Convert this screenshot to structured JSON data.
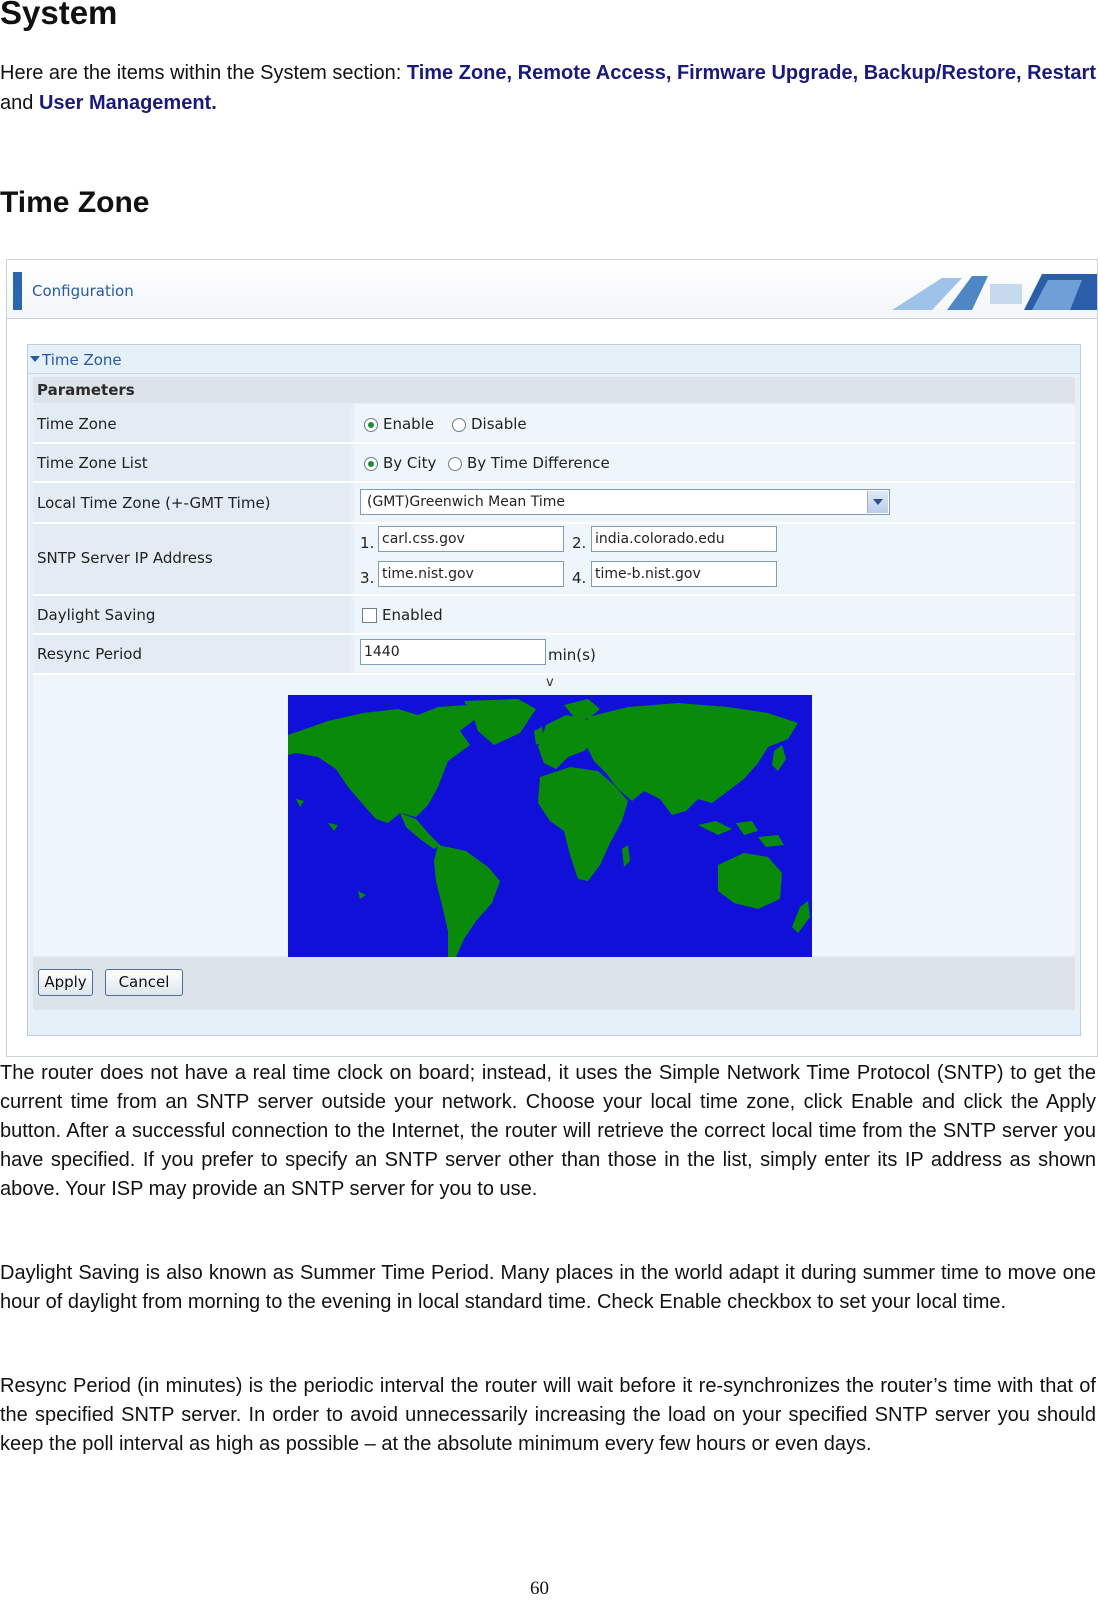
{
  "heading": "System",
  "intro": {
    "prefix": "Here are the items within the System section: ",
    "highlight1": "Time Zone, Remote Access, Firmware Upgrade, Backup/Restore, Restart",
    "middle": " and ",
    "highlight2": "User Management."
  },
  "section_heading": "Time Zone",
  "screenshot": {
    "header_title": "Configuration",
    "panel_title": "Time Zone",
    "parameters_label": "Parameters",
    "rows": {
      "time_zone": {
        "label": "Time Zone",
        "opt1": "Enable",
        "opt2": "Disable",
        "selected": "Enable"
      },
      "time_zone_list": {
        "label": "Time Zone List",
        "opt1": "By City",
        "opt2": "By Time Difference",
        "selected": "By City"
      },
      "local_tz": {
        "label": "Local Time Zone (+-GMT Time)",
        "value": "(GMT)Greenwich Mean Time"
      },
      "sntp": {
        "label": "SNTP Server IP Address",
        "n1": "1.",
        "s1": "carl.css.gov",
        "n2": "2.",
        "s2": "india.colorado.edu",
        "n3": "3.",
        "s3": "time.nist.gov",
        "n4": "4.",
        "s4": "time-b.nist.gov"
      },
      "daylight": {
        "label": "Daylight Saving",
        "checkbox_label": "Enabled",
        "checked": false
      },
      "resync": {
        "label": "Resync Period",
        "value": "1440",
        "unit": "min(s)"
      }
    },
    "map_marker": "v",
    "map_colors": {
      "ocean": "#1010d8",
      "land": "#0a8a0a"
    },
    "buttons": {
      "apply": "Apply",
      "cancel": "Cancel"
    }
  },
  "paragraphs": [
    "The router does not have a real time clock on board; instead, it uses the Simple Network Time Protocol (SNTP) to get the current time from an SNTP server outside your network. Choose your local time zone, click Enable and click the Apply button. After a successful connection to the Internet, the router will retrieve the correct local time from the SNTP server you have specified. If you prefer to specify an SNTP server other than those in the list, simply enter its IP address as shown above. Your ISP may provide an SNTP server for you to use.",
    "Daylight Saving is also known as Summer Time Period. Many places in the world adapt it during summer time to move one hour of daylight from morning to the evening in local standard time. Check Enable checkbox to set your local time.",
    "Resync Period (in minutes) is the periodic interval the router will wait before it re-synchronizes the router’s time with that of the specified SNTP server. In order to avoid unnecessarily increasing the load on your specified SNTP server you should keep the poll interval as high as possible – at the absolute minimum every few hours or even days."
  ],
  "page_number": "60"
}
